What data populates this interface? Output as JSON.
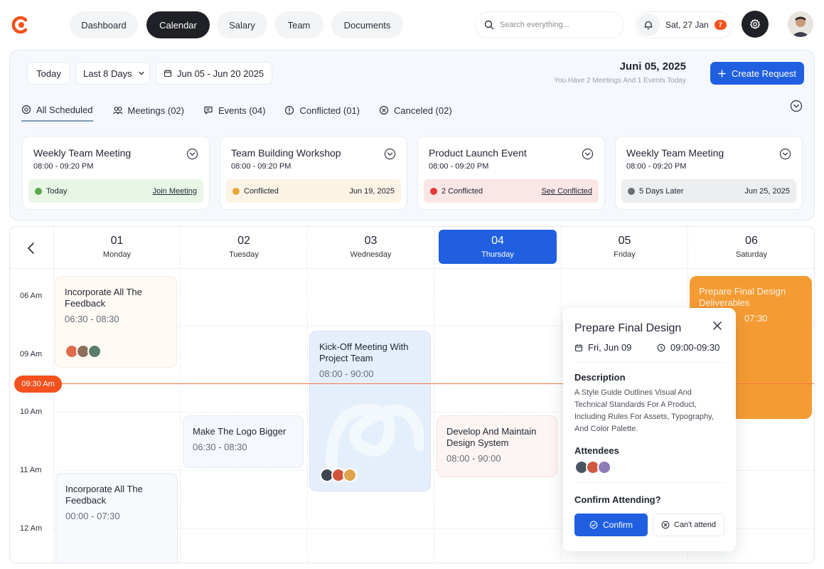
{
  "colors": {
    "accent": "#1f5fe0",
    "danger": "#f4511e",
    "warning": "#f5a030",
    "success": "#4caf50",
    "ink": "#1f2126"
  },
  "nav": {
    "items": [
      "Dashboard",
      "Calendar",
      "Salary",
      "Team",
      "Documents"
    ],
    "active": "Calendar",
    "search_placeholder": "Search everything...",
    "date": "Sat, 27 Jan",
    "notifications": "7"
  },
  "toolbar": {
    "today_label": "Today",
    "range_select": "Last 8 Days",
    "date_range": "Jun 05 - Jun 20 2025",
    "current_date": "Juni 05, 2025",
    "summary": "You Have 2 Meetings And 1 Events Today",
    "create_label": "Create Request"
  },
  "tabs": [
    {
      "label": "All Scheduled",
      "icon": "scheduled-icon"
    },
    {
      "label": "Meetings (02)",
      "icon": "users-icon"
    },
    {
      "label": "Events (04)",
      "icon": "message-icon"
    },
    {
      "label": "Conflicted (01)",
      "icon": "alert-icon"
    },
    {
      "label": "Canceled (02)",
      "icon": "cancel-icon"
    }
  ],
  "event_cards": [
    {
      "title": "Weekly Team Meeting",
      "time": "08:00 - 09:20 PM",
      "status": "Today",
      "action": "Join Meeting",
      "tone": "success"
    },
    {
      "title": "Team Building Workshop",
      "time": "08:00 - 09:20 PM",
      "status": "Conflicted",
      "action": "Jun 19, 2025",
      "tone": "warning"
    },
    {
      "title": "Product Launch Event",
      "time": "08:00 - 09:20 PM",
      "status": "2 Conflicted",
      "action": "See Conflicted",
      "tone": "danger"
    },
    {
      "title": "Weekly Team Meeting",
      "time": "08:00 - 09:20 PM",
      "status": "5 Days Later",
      "action": "Jun 25, 2025",
      "tone": "neutral"
    }
  ],
  "calendar": {
    "days": [
      {
        "num": "01",
        "name": "Monday"
      },
      {
        "num": "02",
        "name": "Tuesday"
      },
      {
        "num": "03",
        "name": "Wednesday"
      },
      {
        "num": "04",
        "name": "Thursday"
      },
      {
        "num": "05",
        "name": "Friday"
      },
      {
        "num": "06",
        "name": "Saturday"
      }
    ],
    "active_day": "04",
    "times": [
      "06 Am",
      "09 Am",
      "10 Am",
      "11 Am",
      "12 Am"
    ],
    "now": "09:30 Am",
    "events": [
      {
        "title": "Incorporate All The Feedback",
        "time": "06:30 - 08:30"
      },
      {
        "title": "Incorporate All The Feedback",
        "time": "00:00 - 07:30"
      },
      {
        "title": "Make The Logo Bigger",
        "time": "06:30 - 08:30"
      },
      {
        "title": "Kick-Off Meeting With Project Team",
        "time": "08:00 - 90:00"
      },
      {
        "title": "Develop And Maintain Design System",
        "time": "08:00 - 90:00"
      },
      {
        "title": "Prepare Final Design Deliverables",
        "time": "07:30"
      }
    ]
  },
  "popover": {
    "title": "Prepare Final Design",
    "date": "Fri, Jun 09",
    "time": "09:00-09:30",
    "description_heading": "Description",
    "description": "A Style Guide Outlines Visual And Technical Standards For A Product, Including Rules For Assets, Typography, And Color Palette.",
    "attendees_heading": "Attendees",
    "confirm_heading": "Confirm Attending?",
    "confirm_label": "Confirm",
    "cant_label": "Can't attend"
  }
}
